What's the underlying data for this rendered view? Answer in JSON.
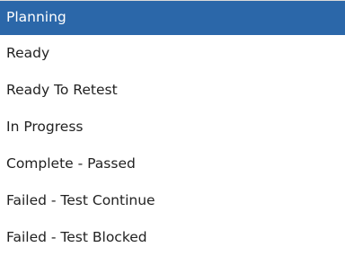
{
  "dropdown": {
    "selected_index": 0,
    "colors": {
      "selected_background": "#2b67a9",
      "selected_text": "#ffffff",
      "text": "#222222"
    },
    "items": [
      {
        "label": "Planning"
      },
      {
        "label": "Ready"
      },
      {
        "label": "Ready To Retest"
      },
      {
        "label": "In Progress"
      },
      {
        "label": "Complete - Passed"
      },
      {
        "label": "Failed - Test Continue"
      },
      {
        "label": "Failed - Test Blocked"
      }
    ]
  }
}
